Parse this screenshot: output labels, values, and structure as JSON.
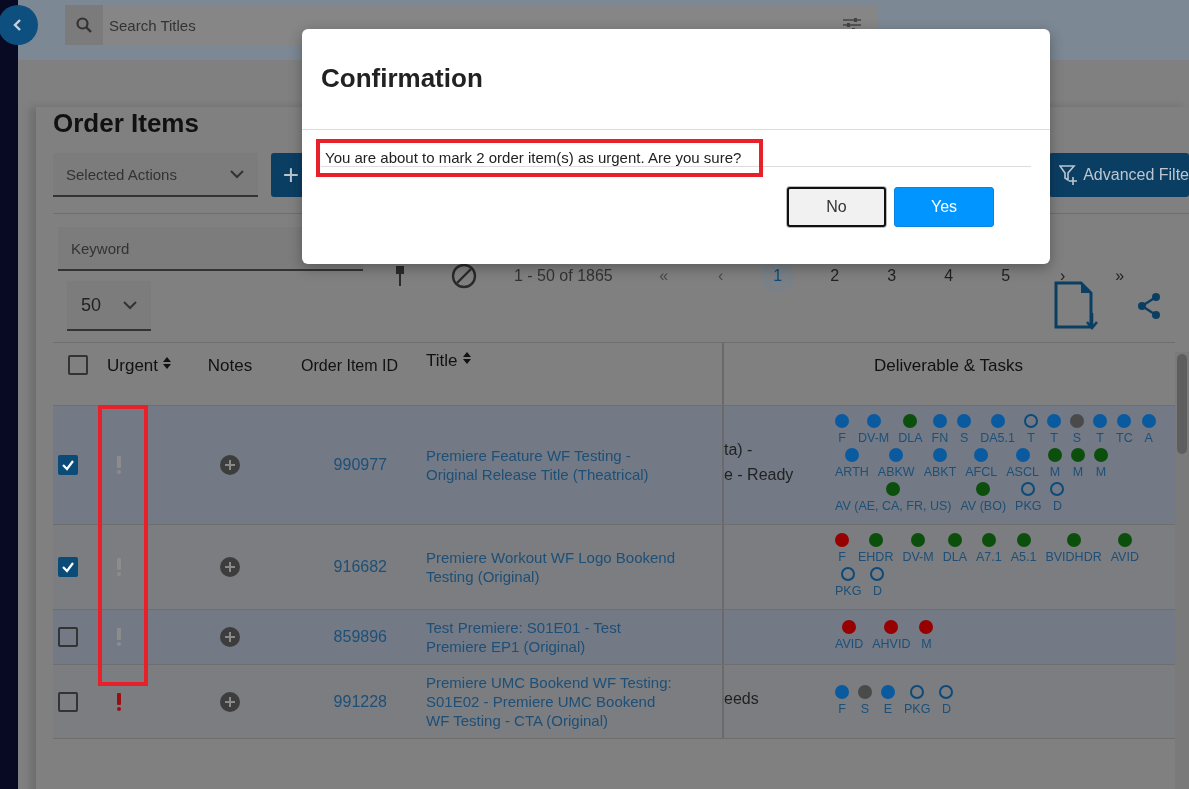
{
  "search": {
    "placeholder": "Search Titles"
  },
  "page_title": "Order Items",
  "actions_dropdown": {
    "value": "Selected Actions"
  },
  "add_button": {
    "label": "+"
  },
  "advanced_filter_button": {
    "label": "Advanced Filte"
  },
  "keyword_field": {
    "placeholder": "Keyword"
  },
  "pagination": {
    "range": "1 - 50 of 1865",
    "first": "«",
    "prev": "‹",
    "next": "›",
    "last": "»",
    "pages": [
      {
        "label": "1",
        "selected": true
      },
      {
        "label": "2",
        "selected": false
      },
      {
        "label": "3",
        "selected": false
      },
      {
        "label": "4",
        "selected": false
      },
      {
        "label": "5",
        "selected": false
      }
    ]
  },
  "page_size": {
    "value": "50"
  },
  "table": {
    "all_checked": false,
    "urgent_highlighted": true,
    "columns": [
      {
        "label": "Urgent",
        "sortable": true
      },
      {
        "label": "Notes",
        "sortable": false
      },
      {
        "label": "Order Item ID",
        "sortable": false
      },
      {
        "label": "Title",
        "sortable": true
      },
      {
        "label": "Deliverable & Tasks",
        "sortable": false
      }
    ],
    "rows": [
      {
        "checked": true,
        "urgent": false,
        "id": "990977",
        "title": "Premiere Feature WF Testing - Original Release Title (Theatrical)",
        "column_5": [
          "ta) -",
          "e - Ready"
        ],
        "deliverables": [
          {
            "label": "F",
            "color": "#0a5aa0",
            "kind": "filled"
          },
          {
            "label": "DV-M",
            "color": "#0a5aa0",
            "kind": "filled"
          },
          {
            "label": "DLA",
            "color": "#0c4f0c",
            "kind": "filled"
          },
          {
            "label": "FN",
            "color": "#0a5aa0",
            "kind": "filled"
          },
          {
            "label": "S",
            "color": "#0a5aa0",
            "kind": "filled"
          },
          {
            "label": "DA5.1",
            "color": "#0a5aa0",
            "kind": "filled"
          },
          {
            "label": "T",
            "color": "#0b4a7a",
            "kind": "outline"
          },
          {
            "label": "T",
            "color": "#0a5aa0",
            "kind": "filled"
          },
          {
            "label": "S",
            "color": "#4a4a4a",
            "kind": "filled"
          },
          {
            "label": "T",
            "color": "#0a5aa0",
            "kind": "filled"
          },
          {
            "label": "TC",
            "color": "#0a5aa0",
            "kind": "filled"
          },
          {
            "label": "A",
            "color": "#0a5aa0",
            "kind": "filled"
          },
          {
            "label": "ARTH",
            "color": "#0a5aa0",
            "kind": "filled"
          },
          {
            "label": "ABKW",
            "color": "#0a5aa0",
            "kind": "filled"
          },
          {
            "label": "ABKT",
            "color": "#0a5aa0",
            "kind": "filled"
          },
          {
            "label": "AFCL",
            "color": "#0a5aa0",
            "kind": "filled"
          },
          {
            "label": "ASCL",
            "color": "#0a5aa0",
            "kind": "filled"
          },
          {
            "label": "M",
            "color": "#0c4f0c",
            "kind": "filled"
          },
          {
            "label": "M",
            "color": "#0c4f0c",
            "kind": "filled"
          },
          {
            "label": "M",
            "color": "#0c4f0c",
            "kind": "filled"
          },
          {
            "label": "AV (AE, CA, FR, US)",
            "color": "#0c4f0c",
            "kind": "filled"
          },
          {
            "label": "AV (BO)",
            "color": "#0c4f0c",
            "kind": "filled"
          },
          {
            "label": "PKG",
            "color": "#0b4a7a",
            "kind": "outline"
          },
          {
            "label": "D",
            "color": "#0b4a7a",
            "kind": "outline"
          }
        ]
      },
      {
        "checked": true,
        "urgent": false,
        "id": "916682",
        "title": "Premiere Workout WF Logo Bookend Testing (Original)",
        "deliverables": [
          {
            "label": "F",
            "color": "#960000",
            "kind": "filled"
          },
          {
            "label": "EHDR",
            "color": "#0c4f0c",
            "kind": "filled"
          },
          {
            "label": "DV-M",
            "color": "#0c4f0c",
            "kind": "filled"
          },
          {
            "label": "DLA",
            "color": "#0c4f0c",
            "kind": "filled"
          },
          {
            "label": "A7.1",
            "color": "#0c4f0c",
            "kind": "filled"
          },
          {
            "label": "A5.1",
            "color": "#0c4f0c",
            "kind": "filled"
          },
          {
            "label": "BVIDHDR",
            "color": "#0c4f0c",
            "kind": "filled"
          },
          {
            "label": "AVID",
            "color": "#0c4f0c",
            "kind": "filled"
          },
          {
            "label": "PKG",
            "color": "#0b4a7a",
            "kind": "outline"
          },
          {
            "label": "D",
            "color": "#0b4a7a",
            "kind": "outline"
          }
        ]
      },
      {
        "checked": false,
        "urgent": false,
        "id": "859896",
        "title": "Test Premiere: S01E01 - Test Premiere EP1 (Original)",
        "deliverables": [
          {
            "label": "AVID",
            "color": "#960000",
            "kind": "filled"
          },
          {
            "label": "AHVID",
            "color": "#960000",
            "kind": "filled"
          },
          {
            "label": "M",
            "color": "#960000",
            "kind": "filled"
          }
        ]
      },
      {
        "checked": false,
        "urgent": true,
        "id": "991228",
        "title": "Premiere UMC Bookend WF Testing: S01E02 - Premiere UMC Bookend WF Testing - CTA (Original)",
        "column_5": [
          "eeds"
        ],
        "deliverables": [
          {
            "label": "F",
            "color": "#0a5aa0",
            "kind": "filled"
          },
          {
            "label": "S",
            "color": "#4a4a4a",
            "kind": "filled"
          },
          {
            "label": "E",
            "color": "#0a5aa0",
            "kind": "filled"
          },
          {
            "label": "PKG",
            "color": "#0b4a7a",
            "kind": "outline"
          },
          {
            "label": "D",
            "color": "#0b4a7a",
            "kind": "outline"
          }
        ]
      }
    ]
  },
  "dialog": {
    "title": "Confirmation",
    "message": "You are about to mark 2 order item(s) as urgent. Are you sure?",
    "message_highlighted": true,
    "buttons": [
      {
        "label": "No",
        "kind": "secondary"
      },
      {
        "label": "Yes",
        "kind": "primary"
      }
    ]
  }
}
